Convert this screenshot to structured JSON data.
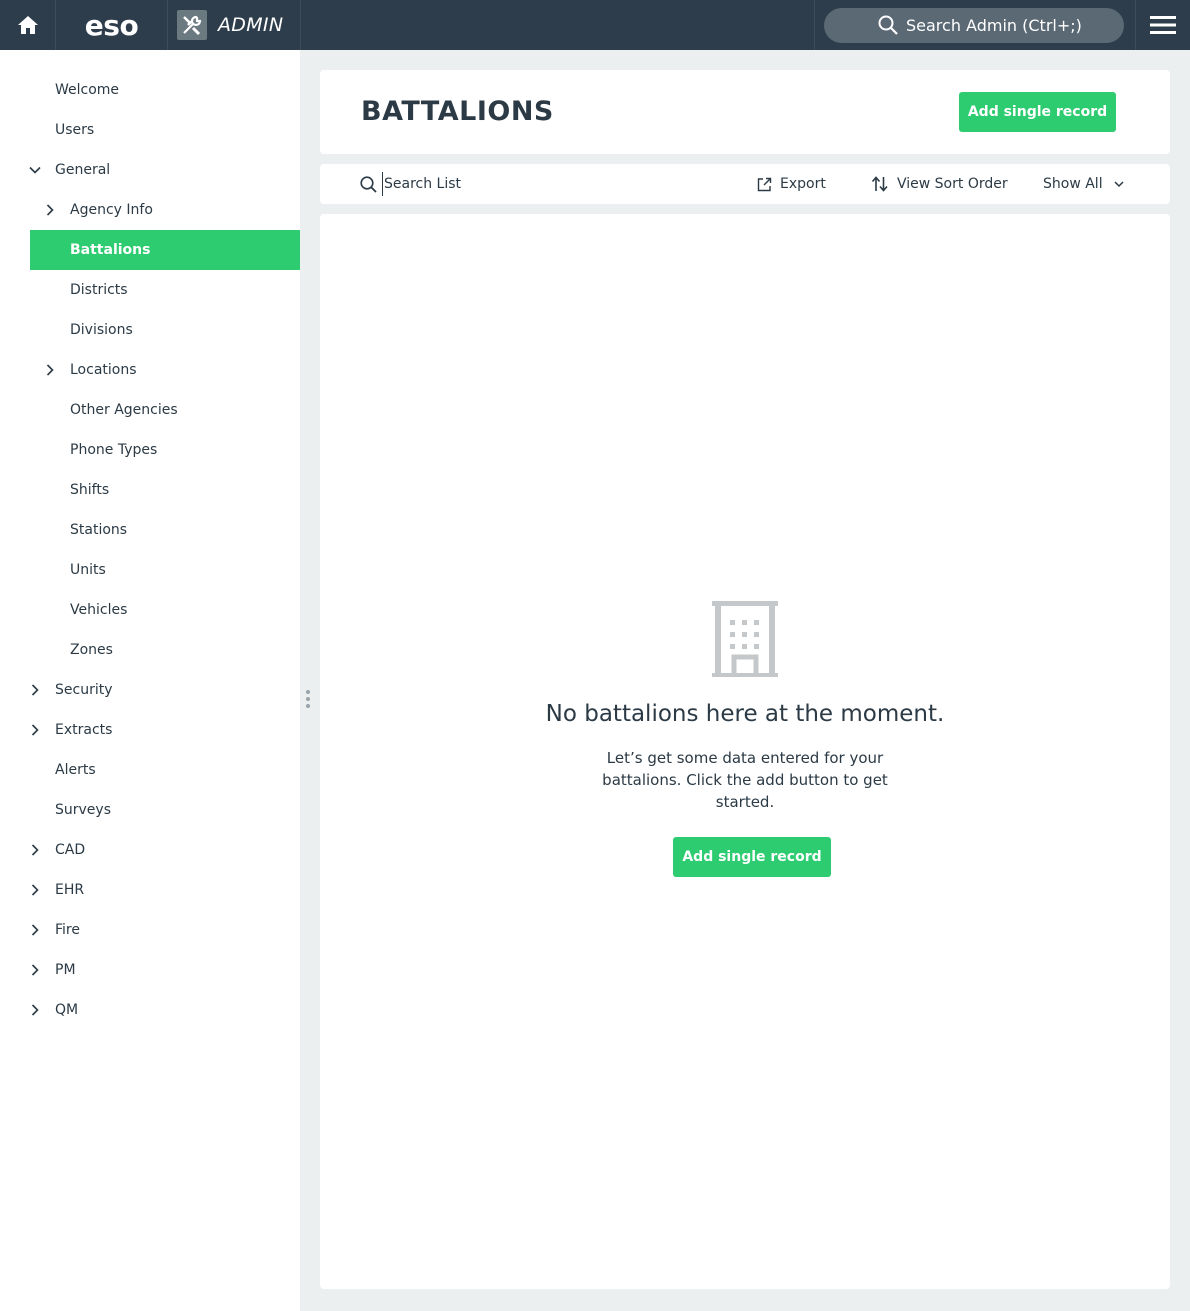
{
  "topbar": {
    "logo": "eso",
    "app_label": "ADMIN",
    "search_label": "Search Admin (Ctrl+;)"
  },
  "sidebar": {
    "items": [
      {
        "label": "Welcome"
      },
      {
        "label": "Users"
      },
      {
        "label": "General"
      },
      {
        "label": "Agency Info"
      },
      {
        "label": "Battalions"
      },
      {
        "label": "Districts"
      },
      {
        "label": "Divisions"
      },
      {
        "label": "Locations"
      },
      {
        "label": "Other Agencies"
      },
      {
        "label": "Phone Types"
      },
      {
        "label": "Shifts"
      },
      {
        "label": "Stations"
      },
      {
        "label": "Units"
      },
      {
        "label": "Vehicles"
      },
      {
        "label": "Zones"
      },
      {
        "label": "Security"
      },
      {
        "label": "Extracts"
      },
      {
        "label": "Alerts"
      },
      {
        "label": "Surveys"
      },
      {
        "label": "CAD"
      },
      {
        "label": "EHR"
      },
      {
        "label": "Fire"
      },
      {
        "label": "PM"
      },
      {
        "label": "QM"
      }
    ],
    "active": "Battalions"
  },
  "header": {
    "title": "BATTALIONS",
    "add_button": "Add single record"
  },
  "toolbar": {
    "search_placeholder": "Search List",
    "export_label": "Export",
    "sort_label": "View Sort Order",
    "show_label": "Show All"
  },
  "empty_state": {
    "icon": "building-icon",
    "title": "No battalions here at the moment.",
    "description": "Let’s get some data entered for your battalions. Click the add button to get started.",
    "button": "Add single record"
  },
  "colors": {
    "topbar": "#2e3d4b",
    "accent": "#2ecc71",
    "text": "#2b3a45",
    "background": "#ecefef"
  }
}
